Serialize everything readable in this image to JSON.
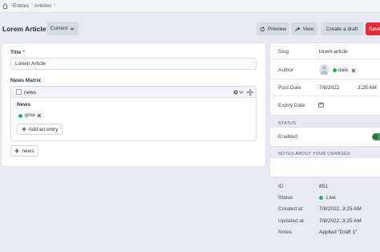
{
  "breadcrumb": {
    "items": [
      "Entries",
      "Articles"
    ]
  },
  "header": {
    "title": "Lorem Article",
    "site_menu_label": "Current",
    "preview_label": "Preview",
    "view_label": "View",
    "create_draft_label": "Create a draft",
    "save_label": "Save"
  },
  "fields": {
    "title_label": "Title",
    "required_mark": "*",
    "title_value": "Lorem Article",
    "matrix_label": "News Matrix",
    "block_name": "news",
    "block_field_label": "News",
    "related_entry": "gma",
    "add_entry_label": "Add an entry",
    "add_block_label": "news"
  },
  "meta": {
    "slug_label": "Slug",
    "slug_value": "lorem-article",
    "author_label": "Author",
    "author_value": "dale",
    "post_date_label": "Post Date",
    "post_date": "7/8/2022",
    "post_time": "3:25 AM",
    "expiry_date_label": "Expiry Date",
    "status_heading": "STATUS",
    "enabled_label": "Enabled",
    "notes_heading": "NOTES ABOUT YOUR CHANGES",
    "notes_placeholder": "",
    "id_label": "ID",
    "id_value": "851",
    "status_label": "Status",
    "status_value": "Live",
    "created_label": "Created at",
    "created_value": "7/8/2022, 3:25 AM",
    "updated_label": "Updated at",
    "updated_value": "7/8/2022, 3:25 AM",
    "notes_label": "Notes",
    "notes_value": "Applied “Draft 1”"
  },
  "colors": {
    "save": "#e12d39",
    "live": "#27ae60",
    "toggle_on": "#3aa05a",
    "background": "#e7ebf1"
  },
  "icons": [
    "home-icon",
    "chevron-right-icon",
    "chevron-down-icon",
    "refresh-icon",
    "share-icon",
    "gear-icon",
    "move-icon",
    "remove-icon",
    "plus-icon",
    "calendar-icon",
    "user-icon"
  ]
}
